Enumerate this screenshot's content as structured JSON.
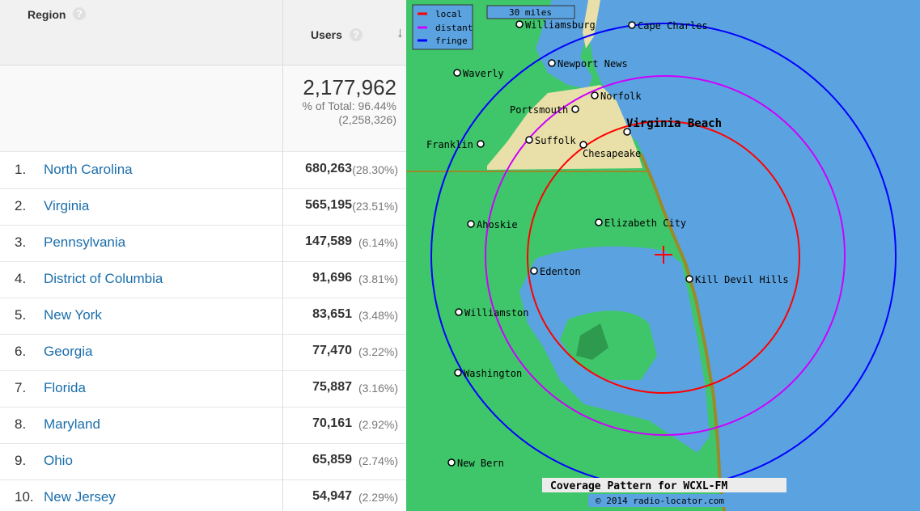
{
  "table": {
    "region_header": "Region",
    "users_header": "Users",
    "help_icon": "?",
    "sort_icon": "↓",
    "total": {
      "value": "2,177,962",
      "pct_label": "% of Total: 96.44%",
      "grand_total": "(2,258,326)"
    },
    "rows": [
      {
        "num": "1.",
        "name": "North Carolina",
        "users": "680,263",
        "pct": "(28.30%)"
      },
      {
        "num": "2.",
        "name": "Virginia",
        "users": "565,195",
        "pct": "(23.51%)"
      },
      {
        "num": "3.",
        "name": "Pennsylvania",
        "users": "147,589",
        "pct": "(6.14%)"
      },
      {
        "num": "4.",
        "name": "District of Columbia",
        "users": "91,696",
        "pct": "(3.81%)"
      },
      {
        "num": "5.",
        "name": "New York",
        "users": "83,651",
        "pct": "(3.48%)"
      },
      {
        "num": "6.",
        "name": "Georgia",
        "users": "77,470",
        "pct": "(3.22%)"
      },
      {
        "num": "7.",
        "name": "Florida",
        "users": "75,887",
        "pct": "(3.16%)"
      },
      {
        "num": "8.",
        "name": "Maryland",
        "users": "70,161",
        "pct": "(2.92%)"
      },
      {
        "num": "9.",
        "name": "Ohio",
        "users": "65,859",
        "pct": "(2.74%)"
      },
      {
        "num": "10.",
        "name": "New Jersey",
        "users": "54,947",
        "pct": "(2.29%)"
      }
    ]
  },
  "map": {
    "legend": {
      "local": "local",
      "distant": "distant",
      "fringe": "fringe"
    },
    "scale": "30 miles",
    "cities": {
      "williamsburg": "Williamsburg",
      "cape_charles": "Cape Charles",
      "newport_news": "Newport News",
      "waverly": "Waverly",
      "norfolk": "Norfolk",
      "portsmouth": "Portsmouth",
      "virginia_beach": "Virginia Beach",
      "franklin": "Franklin",
      "suffolk": "Suffolk",
      "chesapeake": "Chesapeake",
      "elizabeth_city": "Elizabeth City",
      "ahoskie": "Ahoskie",
      "edenton": "Edenton",
      "kill_devil_hills": "Kill Devil Hills",
      "williamston": "Williamston",
      "washington": "Washington",
      "new_bern": "New Bern"
    },
    "title": "Coverage Pattern for WCXL-FM",
    "copyright": "© 2014 radio-locator.com",
    "colors": {
      "local": "#ff0000",
      "distant": "#cc00ff",
      "fringe": "#0000ff",
      "water": "#5ba3e0",
      "land": "#3fc66a",
      "urban": "#e8e0a8"
    }
  }
}
